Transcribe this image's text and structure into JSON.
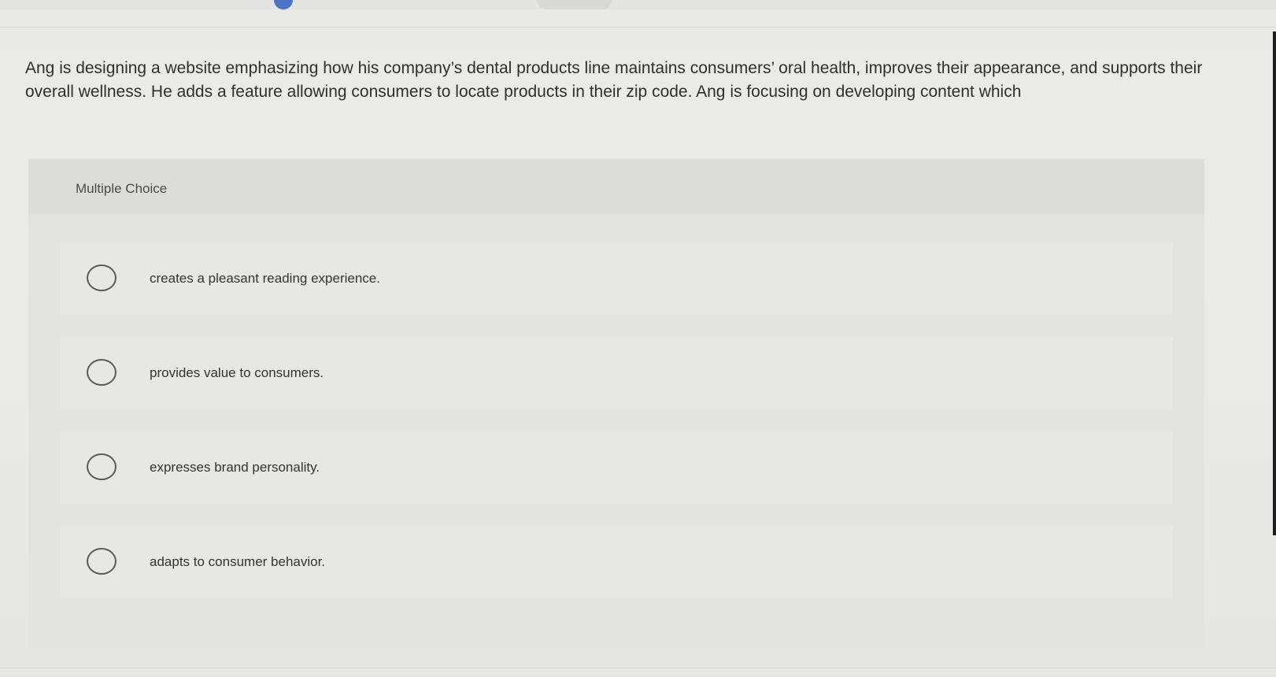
{
  "question": {
    "text": "Ang is designing a website emphasizing how his company’s dental products line maintains consumers’ oral health, improves their appearance, and supports their overall wellness. He adds a feature allowing consumers to locate products in their zip code. Ang is focusing on developing content which"
  },
  "panel": {
    "header": "Multiple Choice",
    "options": [
      {
        "label": "creates a pleasant reading experience."
      },
      {
        "label": "provides value to consumers."
      },
      {
        "label": "expresses brand personality."
      },
      {
        "label": "adapts to consumer behavior."
      }
    ]
  },
  "colors": {
    "background": "#eaeae8",
    "panel": "#e3e3e1",
    "panel_header": "#dcdcda",
    "option_card": "#e7e7e5",
    "text": "#2f2f2f",
    "info_accent": "#4a74c9"
  },
  "icons": {
    "info": "info-icon",
    "radio": "radio-button-icon"
  }
}
